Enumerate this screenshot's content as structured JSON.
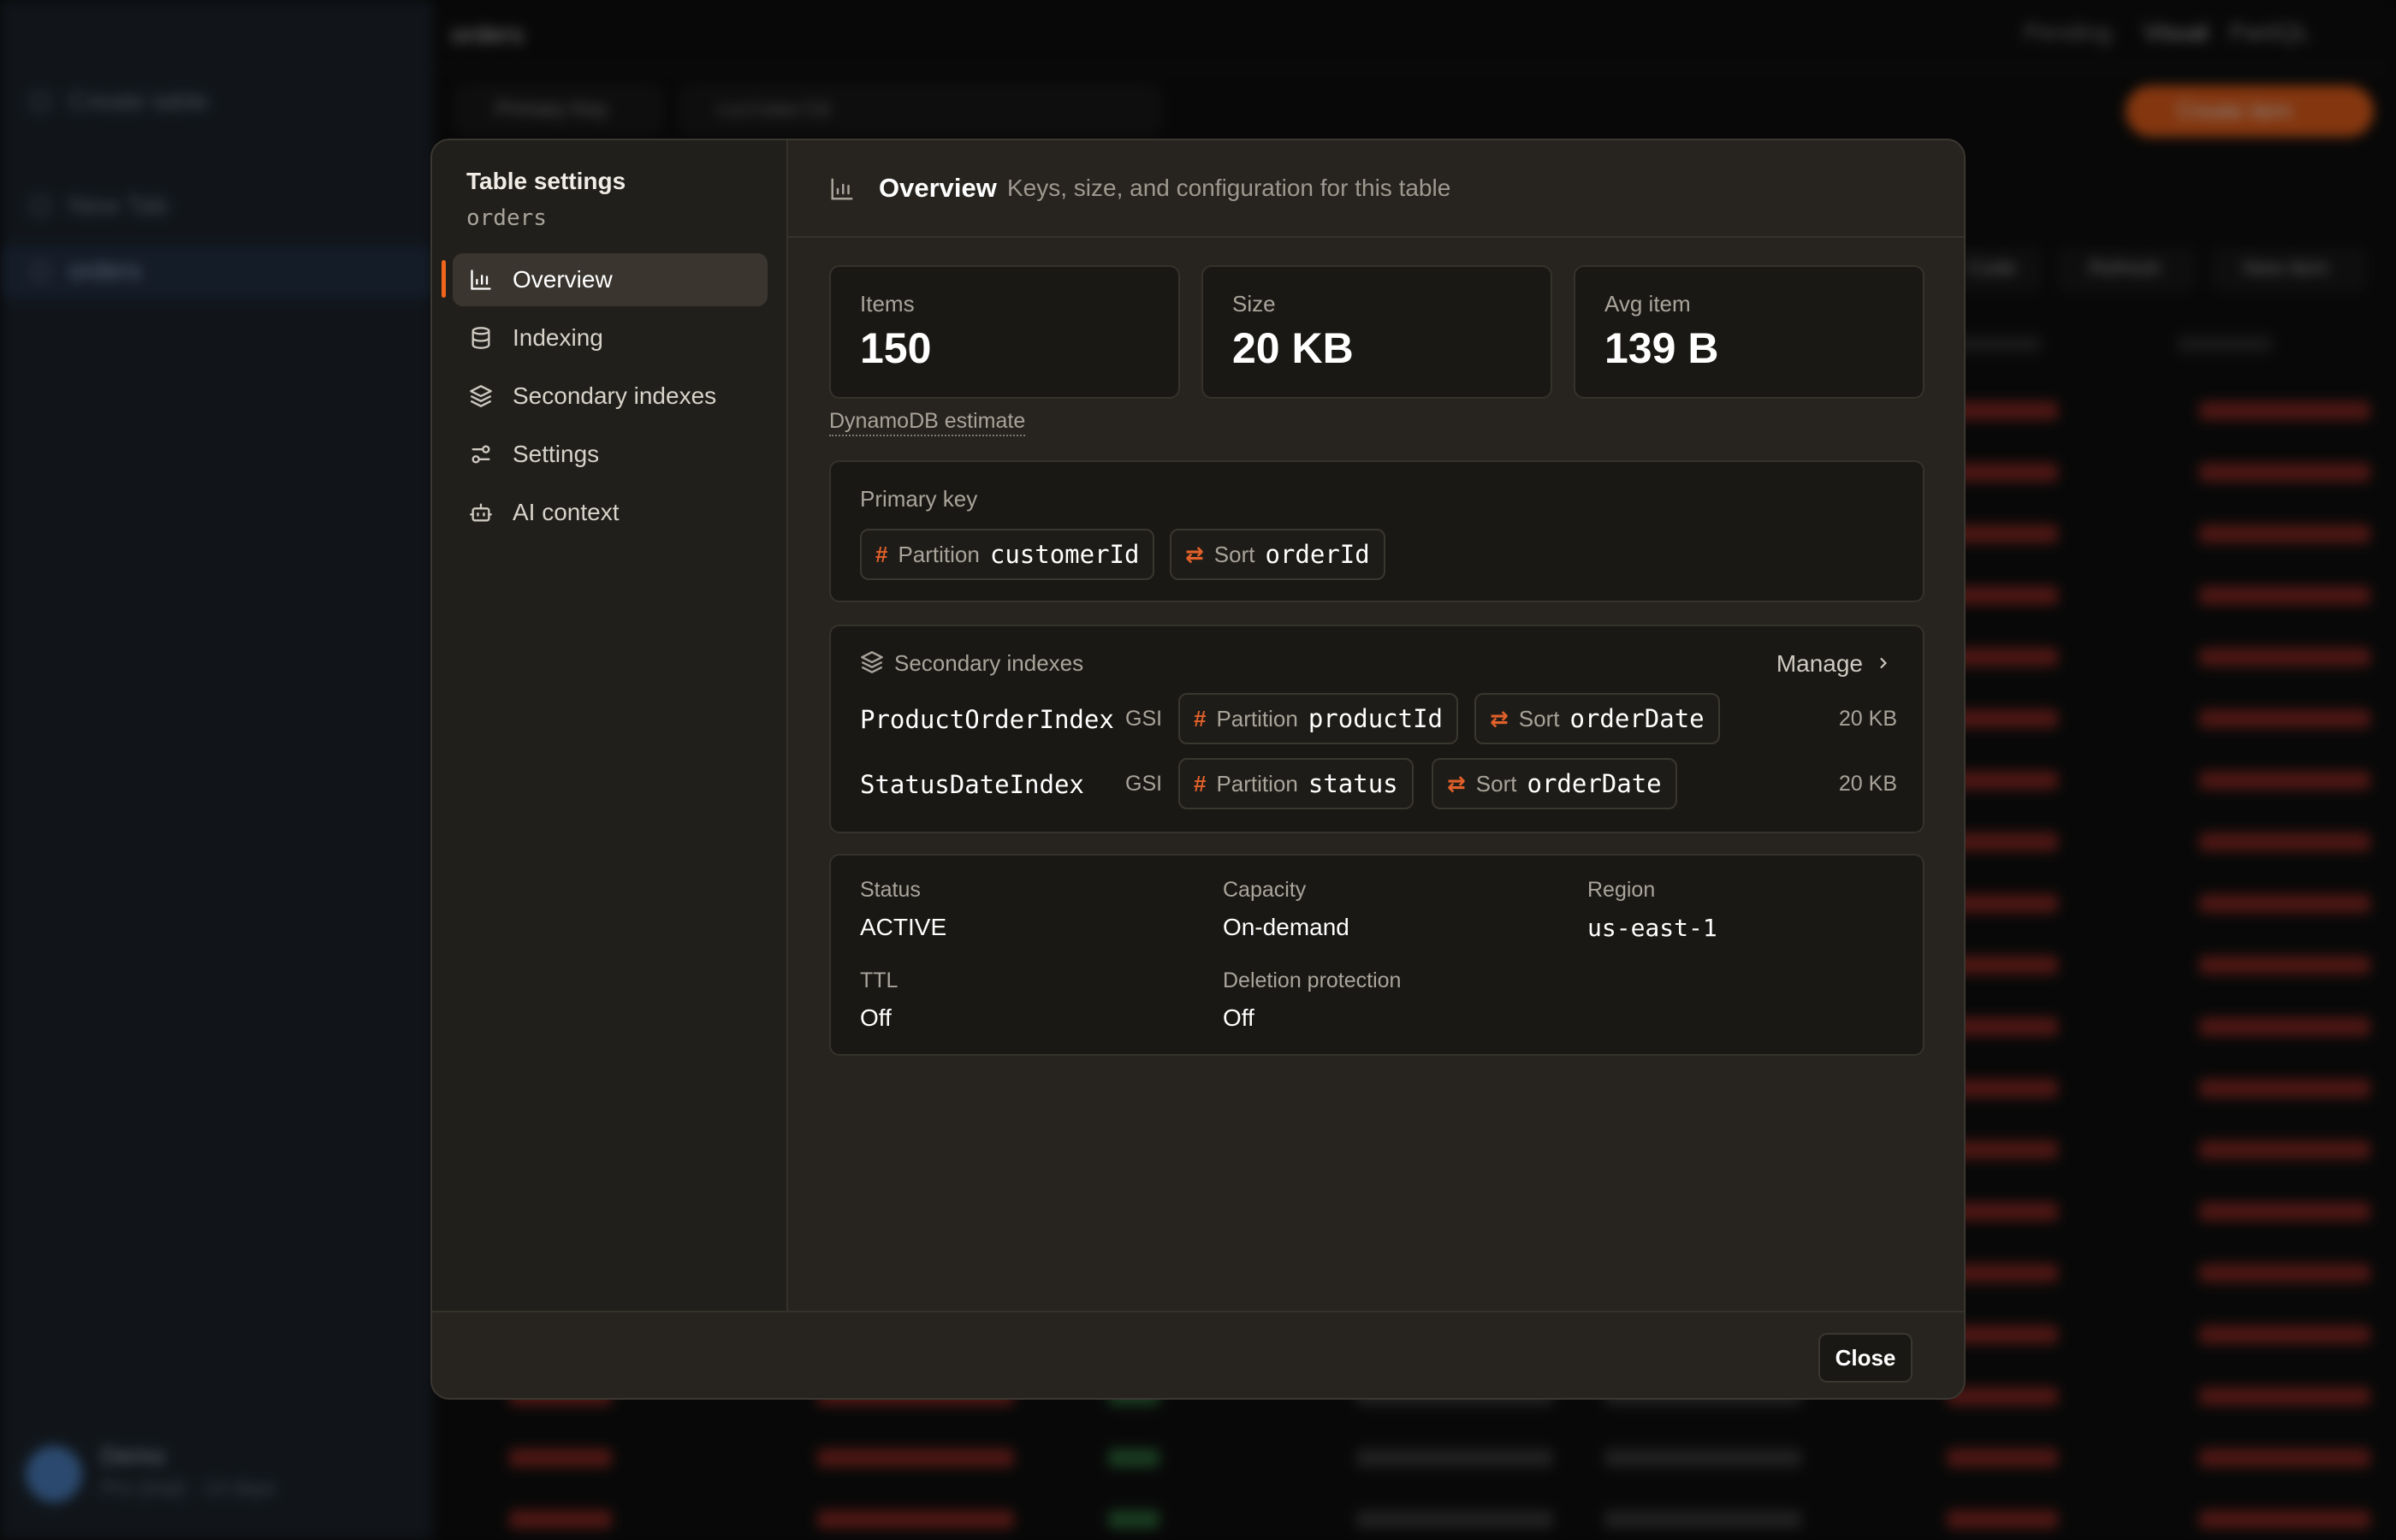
{
  "background": {
    "sidebar": {
      "create_label": "Create table",
      "item_new_tab": "New Tab",
      "item_orders": "orders",
      "user_name": "Demo",
      "user_sub": "Pro (trial) · 14 days"
    },
    "topbar": {
      "title": "orders",
      "pending": "Pending",
      "visual": "Visual",
      "partiql": "PartiQL"
    },
    "toolbar": {
      "primary_key": "Primary Key",
      "customer_id": "customerId",
      "create_item": "Create item",
      "code": "Code",
      "refresh": "Refresh",
      "new_item": "New item"
    }
  },
  "modal": {
    "nav": {
      "title": "Table settings",
      "table_name": "orders",
      "items": [
        {
          "label": "Overview",
          "icon": "bar-chart-icon",
          "active": true
        },
        {
          "label": "Indexing",
          "icon": "database-icon",
          "active": false
        },
        {
          "label": "Secondary indexes",
          "icon": "layers-icon",
          "active": false
        },
        {
          "label": "Settings",
          "icon": "sliders-icon",
          "active": false
        },
        {
          "label": "AI context",
          "icon": "bot-icon",
          "active": false
        }
      ]
    },
    "header": {
      "title": "Overview",
      "description": "Keys, size, and configuration for this table"
    },
    "stats": [
      {
        "label": "Items",
        "value": "150"
      },
      {
        "label": "Size",
        "value": "20 KB"
      },
      {
        "label": "Avg item",
        "value": "139 B"
      }
    ],
    "estimate_note": "DynamoDB estimate",
    "primary_key": {
      "label": "Primary key",
      "partition_kind": "Partition",
      "partition_name": "customerId",
      "sort_kind": "Sort",
      "sort_name": "orderId"
    },
    "secondary_indexes": {
      "label": "Secondary indexes",
      "manage_label": "Manage",
      "rows": [
        {
          "name": "ProductOrderIndex",
          "type": "GSI",
          "partition_kind": "Partition",
          "partition_name": "productId",
          "sort_kind": "Sort",
          "sort_name": "orderDate",
          "size": "20 KB"
        },
        {
          "name": "StatusDateIndex",
          "type": "GSI",
          "partition_kind": "Partition",
          "partition_name": "status",
          "sort_kind": "Sort",
          "sort_name": "orderDate",
          "size": "20 KB"
        }
      ]
    },
    "details": {
      "status_label": "Status",
      "status_value": "ACTIVE",
      "capacity_label": "Capacity",
      "capacity_value": "On-demand",
      "region_label": "Region",
      "region_value": "us-east-1",
      "ttl_label": "TTL",
      "ttl_value": "Off",
      "deletion_label": "Deletion protection",
      "deletion_value": "Off"
    },
    "footer": {
      "close_label": "Close"
    }
  },
  "colors": {
    "accent": "#f0641c",
    "key_icon": "#e0602a",
    "panel_bg": "#1a1815",
    "modal_bg": "#27241f"
  }
}
